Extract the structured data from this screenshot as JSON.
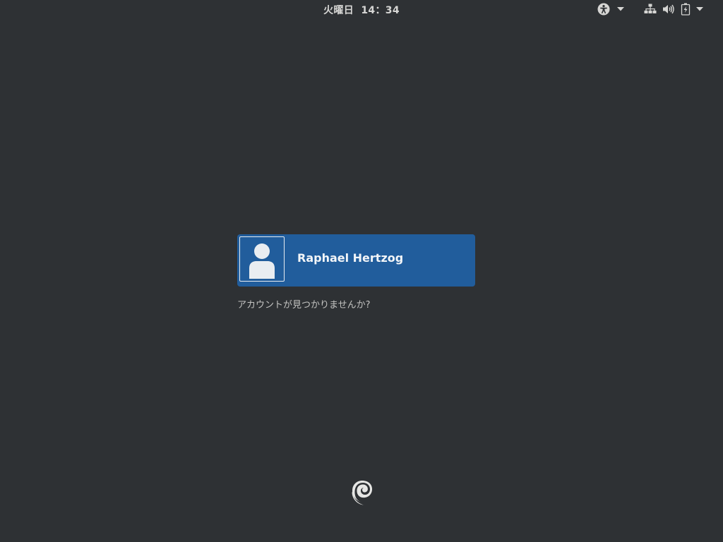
{
  "top_bar": {
    "clock": {
      "day": "火曜日",
      "time": "14：34"
    },
    "indicators": [
      "accessibility-icon",
      "network-wired-icon",
      "volume-high-icon",
      "battery-charging-icon"
    ]
  },
  "login": {
    "users": [
      {
        "name": "Raphael Hertzog",
        "avatar": "default-user-avatar"
      }
    ],
    "not_listed_link": "アカウントが見つかりませんか?"
  },
  "branding": {
    "logo": "debian-swirl-logo"
  },
  "colors": {
    "background": "#2e3134",
    "selected_user_bg": "#215d9c",
    "text": "#d6d6d4"
  }
}
